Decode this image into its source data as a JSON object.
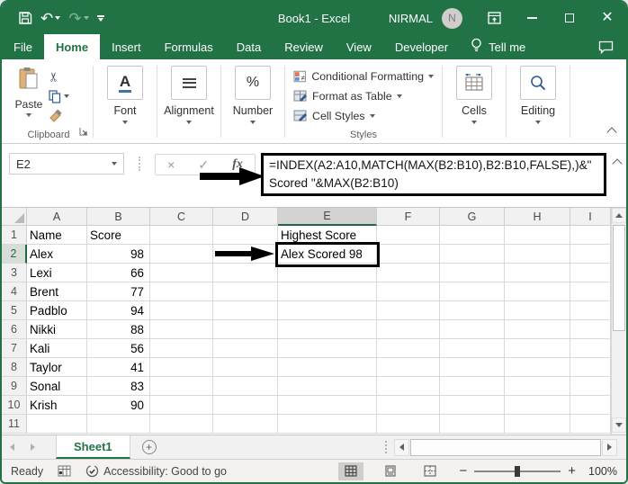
{
  "colors": {
    "brand_green": "#217346",
    "selection_green": "#1e6b41",
    "annotation_black": "#000000",
    "selected_header_bg": "#d2d2d2",
    "gridline": "#d9d9d9"
  },
  "titlebar": {
    "title": "Book1 - Excel",
    "user": "NIRMAL",
    "avatar_initial": "N"
  },
  "ribbon_tabs": [
    "File",
    "Home",
    "Insert",
    "Formulas",
    "Data",
    "Review",
    "View",
    "Developer"
  ],
  "tellme": {
    "label": "Tell me"
  },
  "ribbon": {
    "paste_label": "Paste",
    "groups": {
      "clipboard": "Clipboard",
      "font": "Font",
      "alignment": "Alignment",
      "number": "Number",
      "styles": "Styles",
      "cells": "Cells",
      "editing": "Editing"
    },
    "styles_items": [
      "Conditional Formatting",
      "Format as Table",
      "Cell Styles"
    ]
  },
  "icons": {
    "font_letter": "A",
    "percent": "%",
    "scissors": "✂",
    "fx": "fx",
    "cancel": "×",
    "enter": "✓",
    "plus": "+"
  },
  "formula_bar": {
    "name_box": "E2",
    "line1": "=INDEX(A2:A10,MATCH(MAX(B2:B10),B2:B10,FALSE),)&\"",
    "line2": "Scored \"&MAX(B2:B10)"
  },
  "selection": {
    "active_cell": "E2",
    "selected_column": "E",
    "selected_row": "2"
  },
  "grid": {
    "columns": [
      "A",
      "B",
      "C",
      "D",
      "E",
      "F",
      "G",
      "H",
      "I"
    ],
    "rows": [
      {
        "num": "1",
        "A": "Name",
        "B": "Score",
        "E": "Highest Score"
      },
      {
        "num": "2",
        "A": "Alex",
        "B": "98",
        "E": "Alex Scored 98"
      },
      {
        "num": "3",
        "A": "Lexi",
        "B": "66"
      },
      {
        "num": "4",
        "A": "Brent",
        "B": "77"
      },
      {
        "num": "5",
        "A": "Padblo",
        "B": "94"
      },
      {
        "num": "6",
        "A": "Nikki",
        "B": "88"
      },
      {
        "num": "7",
        "A": "Kali",
        "B": "56"
      },
      {
        "num": "8",
        "A": "Taylor",
        "B": "41"
      },
      {
        "num": "9",
        "A": "Sonal",
        "B": "83"
      },
      {
        "num": "10",
        "A": "Krish",
        "B": "90"
      },
      {
        "num": "11"
      }
    ]
  },
  "sheet_bar": {
    "tabs": [
      "Sheet1"
    ]
  },
  "status_bar": {
    "ready": "Ready",
    "accessibility": "Accessibility: Good to go",
    "zoom_level": "100%"
  }
}
